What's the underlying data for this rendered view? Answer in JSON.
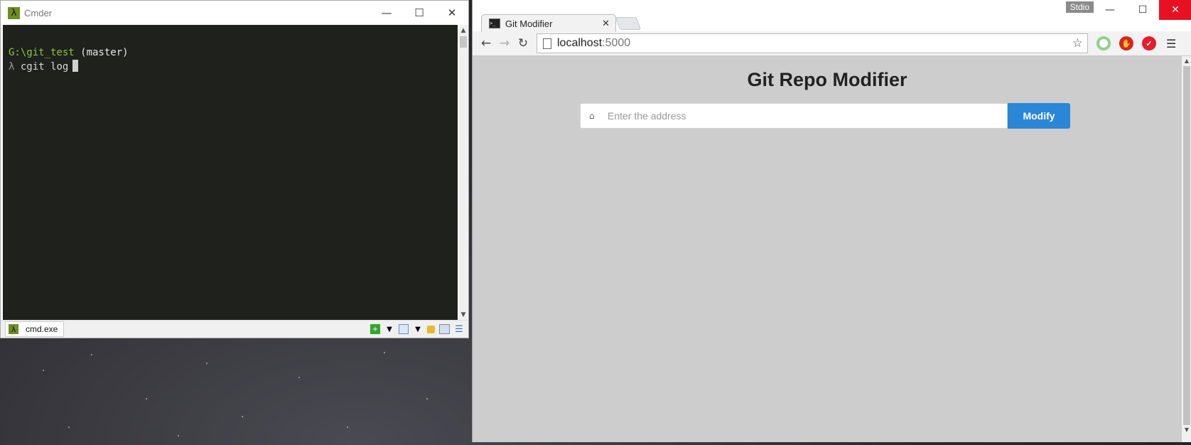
{
  "cmder": {
    "title": "Cmder",
    "app_icon": "lambda-icon",
    "prompt_path": "G:\\git_test",
    "prompt_branch": " (master)",
    "lambda": "λ",
    "command": " cgit log",
    "tab_label": "cmd.exe"
  },
  "browser": {
    "tab_title": "Git Modifier",
    "url_host": "localhost",
    "url_port": ":5000",
    "profile_name": "Stdio",
    "page": {
      "heading": "Git Repo Modifier",
      "address_placeholder": "Enter the address",
      "address_value": "",
      "modify_label": "Modify"
    }
  },
  "colors": {
    "terminal_bg": "#1f211c",
    "prompt_green": "#8cc63f",
    "button_blue": "#2a86d6",
    "close_red": "#e81123"
  }
}
